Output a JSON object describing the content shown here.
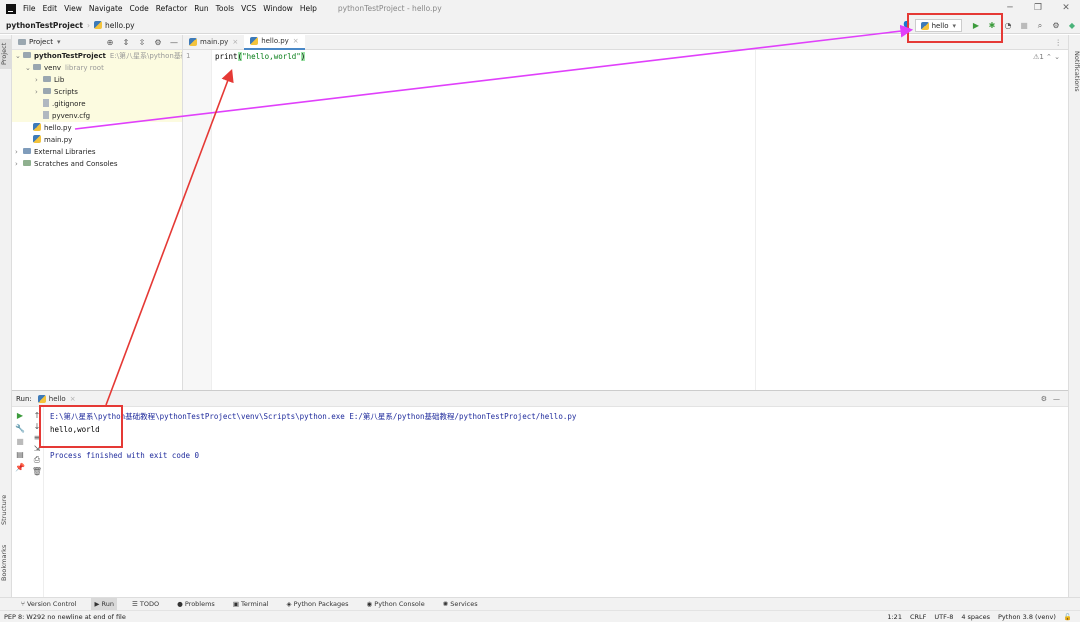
{
  "menu": {
    "items": [
      "File",
      "Edit",
      "View",
      "Navigate",
      "Code",
      "Refactor",
      "Run",
      "Tools",
      "VCS",
      "Window",
      "Help"
    ],
    "window_title": "pythonTestProject - hello.py"
  },
  "navbar": {
    "project": "pythonTestProject",
    "file": "hello.py"
  },
  "run_config": {
    "name": "hello"
  },
  "left_strip": {
    "project": "Project",
    "structure": "Structure",
    "bookmarks": "Bookmarks"
  },
  "right_strip": {
    "notifications": "Notifications"
  },
  "project_panel": {
    "title": "Project",
    "tree": [
      {
        "label": "pythonTestProject",
        "extra": "E:\\第八星系\\python基础教",
        "indent": 0,
        "kind": "folder",
        "bold": true
      },
      {
        "label": "venv",
        "extra": "library root",
        "indent": 1,
        "kind": "folder"
      },
      {
        "label": "Lib",
        "indent": 2,
        "kind": "folder"
      },
      {
        "label": "Scripts",
        "indent": 2,
        "kind": "folder"
      },
      {
        "label": ".gitignore",
        "indent": 2,
        "kind": "file"
      },
      {
        "label": "pyvenv.cfg",
        "indent": 2,
        "kind": "file"
      },
      {
        "label": "hello.py",
        "indent": 1,
        "kind": "py"
      },
      {
        "label": "main.py",
        "indent": 1,
        "kind": "py"
      },
      {
        "label": "External Libraries",
        "indent": 0,
        "kind": "lib"
      },
      {
        "label": "Scratches and Consoles",
        "indent": 0,
        "kind": "scratch"
      }
    ]
  },
  "editor": {
    "tabs": [
      {
        "label": "main.py",
        "active": false
      },
      {
        "label": "hello.py",
        "active": true
      }
    ],
    "line_number": "1",
    "code_fn": "print",
    "code_open": "(",
    "code_str": "\"hello,world\"",
    "code_close": ")",
    "warnings": "⚠1"
  },
  "run_panel": {
    "label": "Run:",
    "tab": "hello",
    "cmd": "E:\\第八星系\\python基础教程\\pythonTestProject\\venv\\Scripts\\python.exe E:/第八星系/python基础教程/pythonTestProject/hello.py",
    "output": "hello,world",
    "finished": "Process finished with exit code 0"
  },
  "bottom_tabs": [
    "Version Control",
    "Run",
    "TODO",
    "Problems",
    "Terminal",
    "Python Packages",
    "Python Console",
    "Services"
  ],
  "status": {
    "message": "PEP 8: W292 no newline at end of file",
    "position": "1:21",
    "line_sep": "CRLF",
    "encoding": "UTF-8",
    "indent": "4 spaces",
    "interpreter": "Python 3.8 (venv)"
  },
  "colors": {
    "annotation_red": "#e53935",
    "annotation_magenta": "#e040fb",
    "run_green": "#3c9b3c"
  }
}
